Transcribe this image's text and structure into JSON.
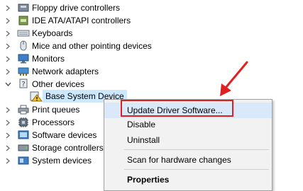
{
  "device_tree": [
    {
      "label": "Floppy drive controllers",
      "icon": "floppy-controller-icon",
      "expanded": false
    },
    {
      "label": "IDE ATA/ATAPI controllers",
      "icon": "ide-controller-icon",
      "expanded": false
    },
    {
      "label": "Keyboards",
      "icon": "keyboard-icon",
      "expanded": false
    },
    {
      "label": "Mice and other pointing devices",
      "icon": "mouse-icon",
      "expanded": false
    },
    {
      "label": "Monitors",
      "icon": "monitor-icon",
      "expanded": false
    },
    {
      "label": "Network adapters",
      "icon": "network-adapter-icon",
      "expanded": false
    },
    {
      "label": "Other devices",
      "icon": "other-devices-icon",
      "expanded": true
    },
    {
      "label": "Base System Device",
      "icon": "warning-device-icon",
      "selected": true
    },
    {
      "label": "Print queues",
      "icon": "printer-icon",
      "expanded": false
    },
    {
      "label": "Processors",
      "icon": "processor-icon",
      "expanded": false
    },
    {
      "label": "Software devices",
      "icon": "software-device-icon",
      "expanded": false
    },
    {
      "label": "Storage controllers",
      "icon": "storage-controller-icon",
      "expanded": false
    },
    {
      "label": "System devices",
      "icon": "system-device-icon",
      "expanded": false
    }
  ],
  "context_menu": {
    "items": [
      {
        "label": "Update Driver Software...",
        "highlighted": true
      },
      {
        "label": "Disable"
      },
      {
        "label": "Uninstall"
      },
      {
        "label": "Scan for hardware changes"
      },
      {
        "label": "Properties",
        "bold": true
      }
    ]
  },
  "colors": {
    "annotation": "#e02020",
    "selection": "#cce8ff",
    "menu_highlight": "#d9e9f9"
  }
}
